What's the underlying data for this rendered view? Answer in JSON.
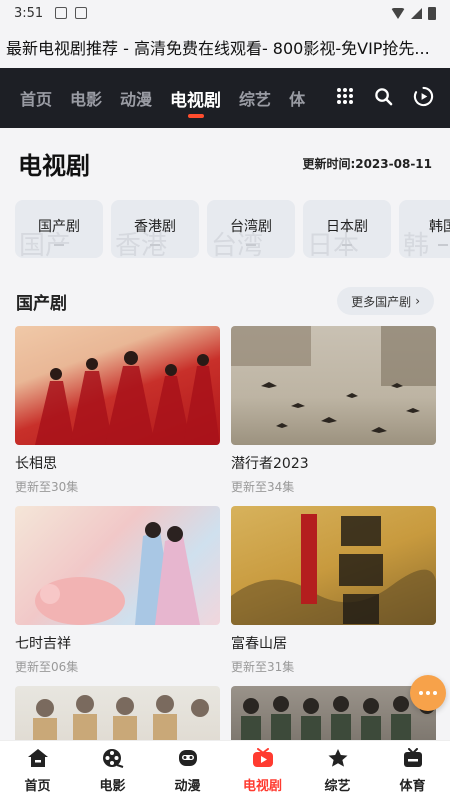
{
  "status_bar": {
    "time": "3:51"
  },
  "page_title": "最新电视剧推荐 - 高清免费在线观看- 800影视-免VIP抢先...",
  "top_nav": {
    "tabs": [
      {
        "label": "首页"
      },
      {
        "label": "电影"
      },
      {
        "label": "动漫"
      },
      {
        "label": "电视剧",
        "active": true
      },
      {
        "label": "综艺"
      },
      {
        "label": "体"
      }
    ],
    "icons": [
      "grid-icon",
      "search-icon",
      "history-icon"
    ]
  },
  "header": {
    "title": "电视剧",
    "update": "更新时间:2023-08-11"
  },
  "categories": [
    {
      "label": "国产剧",
      "bg": "国产"
    },
    {
      "label": "香港剧",
      "bg": "香港"
    },
    {
      "label": "台湾剧",
      "bg": "台湾"
    },
    {
      "label": "日本剧",
      "bg": "日本"
    },
    {
      "label": "韩国",
      "bg": "韩"
    }
  ],
  "section": {
    "title": "国产剧",
    "more_label": "更多国产剧",
    "items": [
      {
        "title": "长相思",
        "sub": "更新至30集"
      },
      {
        "title": "潜行者2023",
        "sub": "更新至34集"
      },
      {
        "title": "七时吉祥",
        "sub": "更新至06集"
      },
      {
        "title": "富春山居",
        "sub": "更新至31集"
      },
      {
        "title": "",
        "sub": ""
      },
      {
        "title": "",
        "sub": ""
      }
    ]
  },
  "bottom_nav": [
    {
      "label": "首页",
      "icon": "home-icon"
    },
    {
      "label": "电影",
      "icon": "film-reel-icon"
    },
    {
      "label": "动漫",
      "icon": "anime-face-icon"
    },
    {
      "label": "电视剧",
      "icon": "tv-play-icon",
      "active": true
    },
    {
      "label": "综艺",
      "icon": "star-icon"
    },
    {
      "label": "体育",
      "icon": "sports-tv-icon"
    }
  ],
  "colors": {
    "accent": "#ff4d2e",
    "nav_bg": "#1d1f25",
    "fab": "#f7a24a",
    "active_bottom": "#ff3b30"
  }
}
